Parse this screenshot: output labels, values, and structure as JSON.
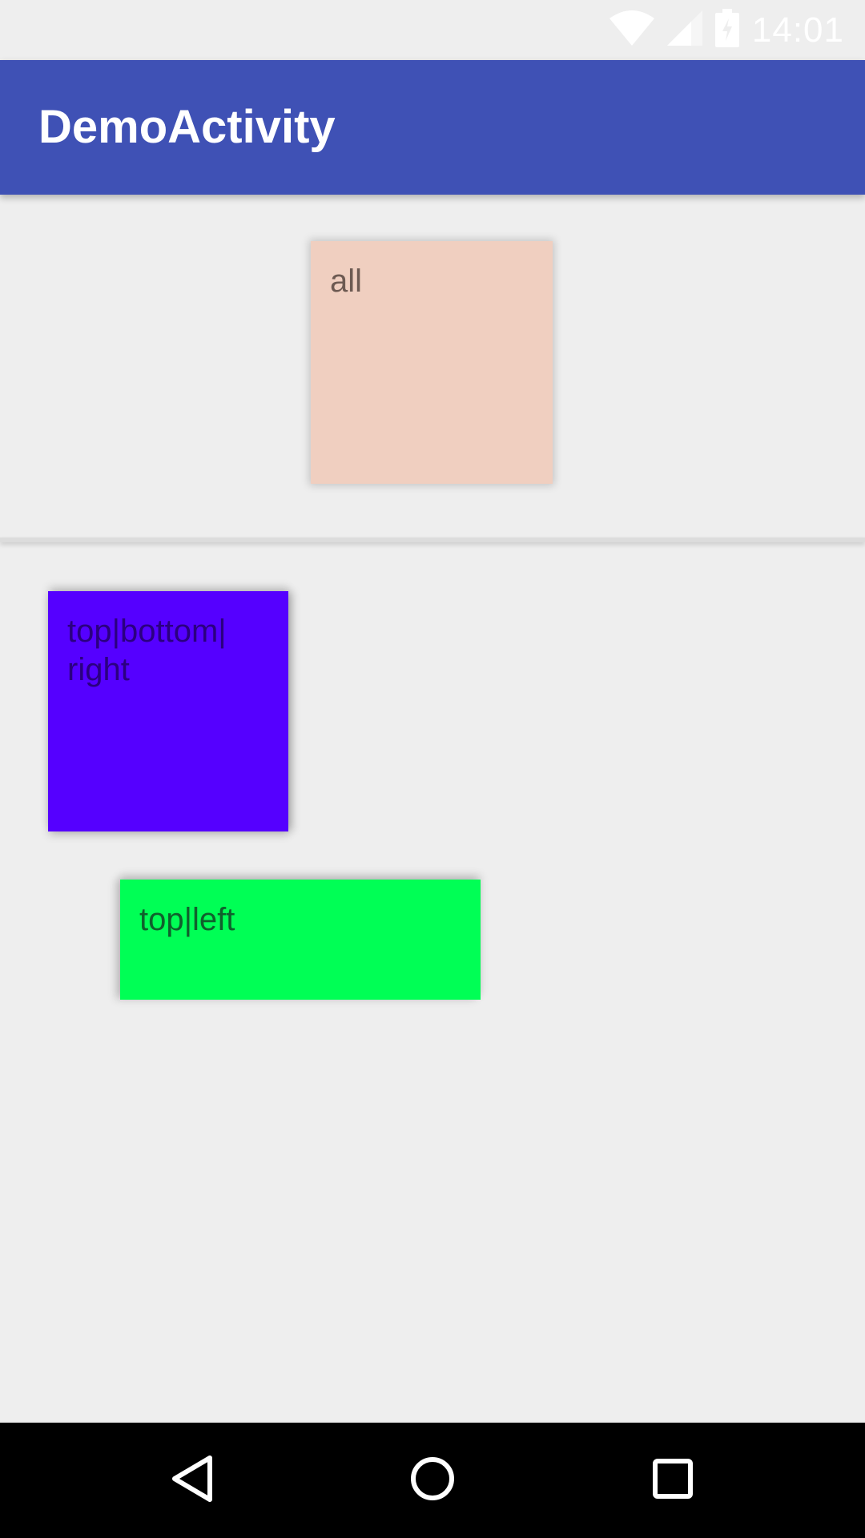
{
  "status_bar": {
    "time": "14:01",
    "icons": [
      "wifi-icon",
      "cell-signal-icon",
      "battery-charging-icon"
    ]
  },
  "app_bar": {
    "title": "DemoActivity",
    "color": "#3f51b5"
  },
  "cards": {
    "all": {
      "label": "all",
      "color": "#f0cfc0"
    },
    "top_bottom_right": {
      "label": "top|bottom|\nright",
      "line1": "top|bottom|",
      "line2": "right",
      "color": "#5500ff"
    },
    "top_left": {
      "label": "top|left",
      "color": "#00ff55"
    }
  },
  "nav_bar": {
    "buttons": [
      "back-icon",
      "home-icon",
      "recents-icon"
    ]
  }
}
